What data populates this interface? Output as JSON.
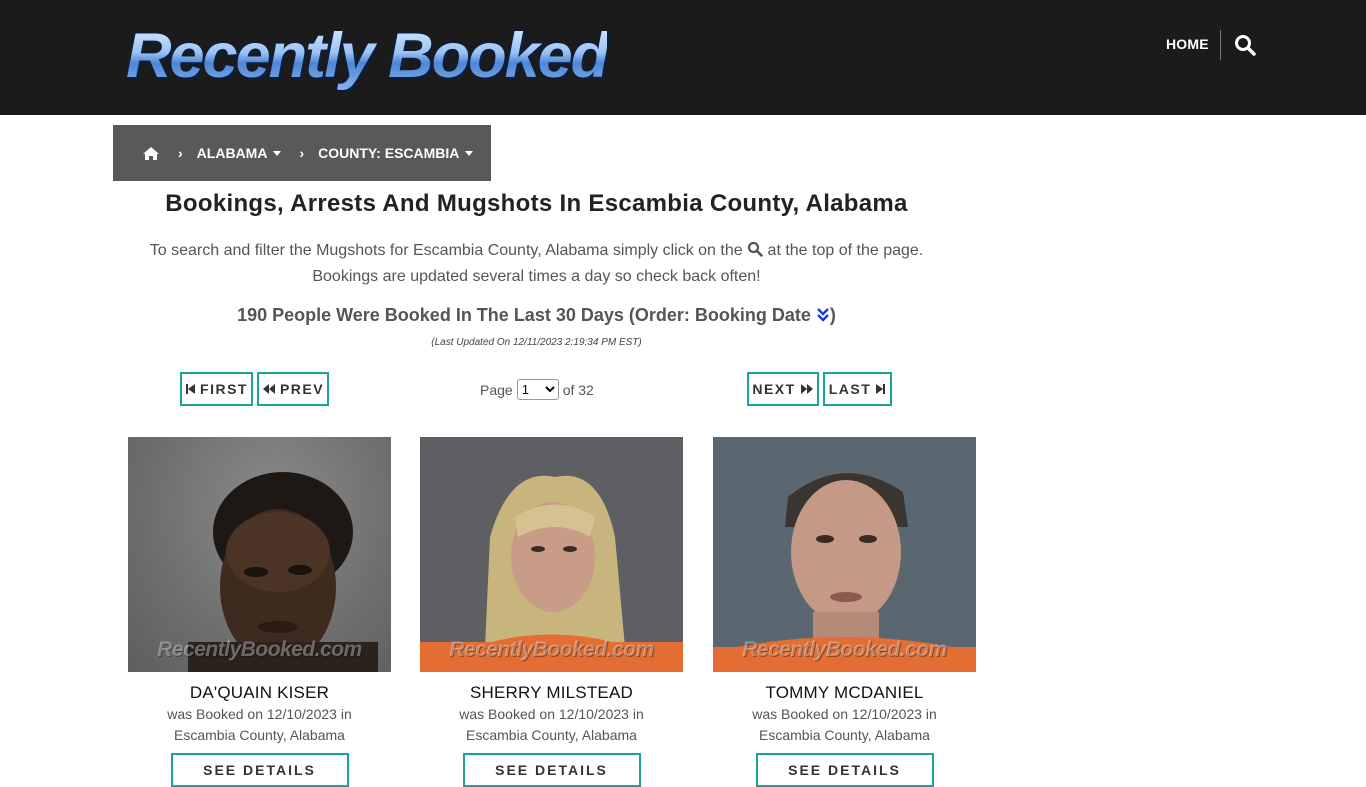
{
  "header": {
    "logo_text": "Recently Booked",
    "nav_home": "HOME",
    "search_icon": "search-icon"
  },
  "breadcrumb": {
    "home_icon": "home-icon",
    "state": "ALABAMA",
    "county": "COUNTY: ESCAMBIA"
  },
  "main": {
    "title": "Bookings, Arrests And Mugshots In Escambia County, Alabama",
    "intro_part1": "To search and filter the Mugshots for Escambia County, Alabama simply click on the",
    "intro_part2": "at the top of the page.",
    "intro_line2": "Bookings are updated several times a day so check back often!",
    "count_text": "190 People Were Booked In The Last 30 Days (Order: Booking Date",
    "count_close": ")",
    "last_updated": "(Last Updated On 12/11/2023 2:19:34 PM EST)"
  },
  "pagination": {
    "first": "FIRST",
    "prev": "PREV",
    "next": "NEXT",
    "last": "LAST",
    "page_label": "Page",
    "current_page": "1",
    "of_label": "of 32"
  },
  "people": [
    {
      "name": "DA'QUAIN KISER",
      "booked": "was Booked on 12/10/2023 in",
      "location": "Escambia County, Alabama",
      "watermark": "RecentlyBooked.com",
      "details": "SEE DETAILS"
    },
    {
      "name": "SHERRY MILSTEAD",
      "booked": "was Booked on 12/10/2023 in",
      "location": "Escambia County, Alabama",
      "watermark": "RecentlyBooked.com",
      "details": "SEE DETAILS"
    },
    {
      "name": "TOMMY MCDANIEL",
      "booked": "was Booked on 12/10/2023 in",
      "location": "Escambia County, Alabama",
      "watermark": "RecentlyBooked.com",
      "details": "SEE DETAILS"
    }
  ],
  "colors": {
    "header_bg": "#1b1b1b",
    "breadcrumb_bg": "#595959",
    "accent": "#1aa39a"
  }
}
